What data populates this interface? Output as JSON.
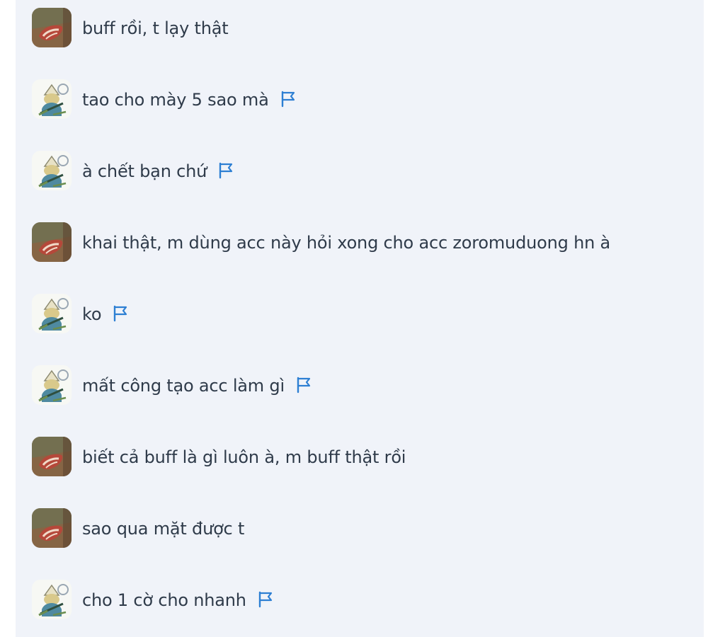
{
  "icons": {
    "flag": "flag-icon",
    "avatar_a": "avatar-brown-icon",
    "avatar_b": "avatar-character-icon"
  },
  "colors": {
    "panel_bg": "#f0f3f9",
    "text": "#2f3b4a",
    "flag": "#2d7fd3"
  },
  "messages": [
    {
      "avatar": "a",
      "text": "buff rồi, t lạy thật",
      "flag": false
    },
    {
      "avatar": "b",
      "text": "tao cho mày 5 sao mà",
      "flag": true
    },
    {
      "avatar": "b",
      "text": "à chết bạn chứ",
      "flag": true
    },
    {
      "avatar": "a",
      "text": "khai thật, m dùng acc này hỏi xong cho acc zoromuduong hn à",
      "flag": false
    },
    {
      "avatar": "b",
      "text": "ko",
      "flag": true
    },
    {
      "avatar": "b",
      "text": "mất công tạo acc làm gì",
      "flag": true
    },
    {
      "avatar": "a",
      "text": "biết cả buff là gì luôn à, m buff thật rồi",
      "flag": false
    },
    {
      "avatar": "a",
      "text": "sao qua mặt được t",
      "flag": false
    },
    {
      "avatar": "b",
      "text": "cho 1 cờ cho nhanh",
      "flag": true
    }
  ]
}
